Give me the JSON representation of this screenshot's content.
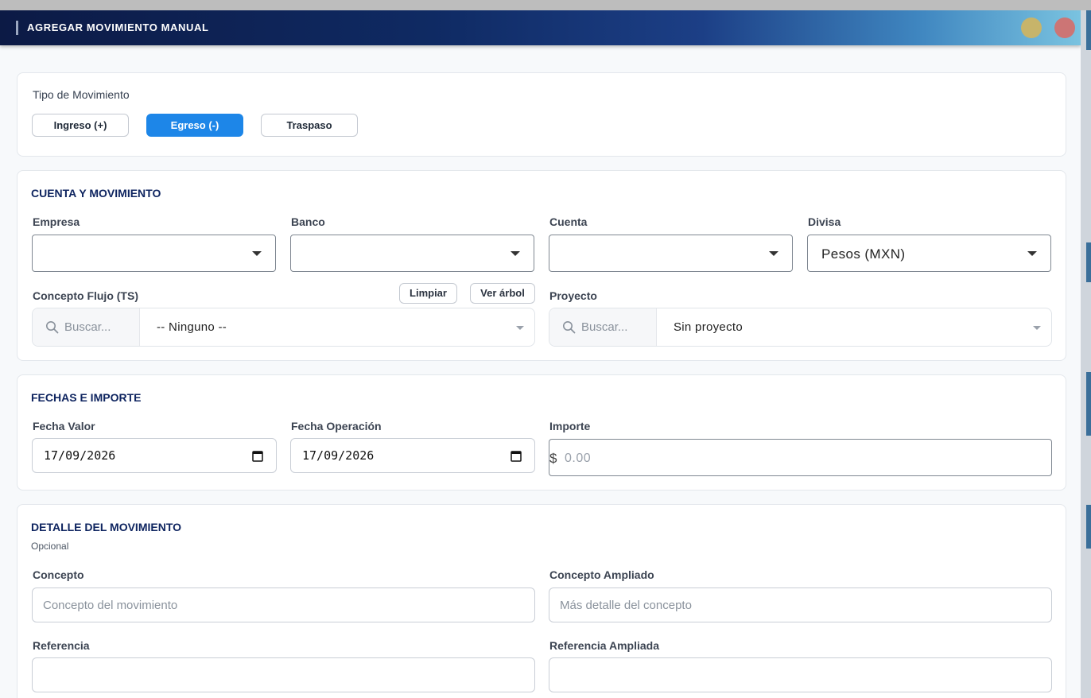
{
  "window": {
    "title": "AGREGAR MOVIMIENTO MANUAL"
  },
  "tipo": {
    "label": "Tipo de Movimiento",
    "options": [
      {
        "label": "Ingreso (+)",
        "active": false
      },
      {
        "label": "Egreso (-)",
        "active": true
      },
      {
        "label": "Traspaso",
        "active": false
      }
    ]
  },
  "cuenta": {
    "title": "CUENTA Y MOVIMIENTO",
    "empresa_label": "Empresa",
    "banco_label": "Banco",
    "cuenta_label": "Cuenta",
    "divisa_label": "Divisa",
    "divisa_value": "Pesos (MXN)",
    "concepto_flujo_label": "Concepto Flujo (TS)",
    "limpiar_label": "Limpiar",
    "ver_arbol_label": "Ver árbol",
    "concepto_search_placeholder": "Buscar...",
    "concepto_value": "-- Ninguno --",
    "proyecto_label": "Proyecto",
    "proyecto_search_placeholder": "Buscar...",
    "proyecto_value": "Sin proyecto"
  },
  "fechas": {
    "title": "FECHAS E IMPORTE",
    "fecha_valor_label": "Fecha Valor",
    "fecha_valor": "17/09/2026",
    "fecha_operacion_label": "Fecha Operación",
    "fecha_operacion": "17/09/2026",
    "importe_label": "Importe",
    "currency_symbol": "$",
    "importe_placeholder": "0.00"
  },
  "detalle": {
    "title": "DETALLE DEL MOVIMIENTO",
    "subtitle": "Opcional",
    "concepto_label": "Concepto",
    "concepto_placeholder": "Concepto del movimiento",
    "concepto_ampliado_label": "Concepto Ampliado",
    "concepto_ampliado_placeholder": "Más detalle del concepto",
    "referencia_label": "Referencia",
    "referencia_ampliada_label": "Referencia Ampliada"
  },
  "colors": {
    "primary": "#1d86e8",
    "heading": "#0f2560",
    "titlebar_start": "#0c1a45",
    "titlebar_end": "#7ac3e0"
  }
}
